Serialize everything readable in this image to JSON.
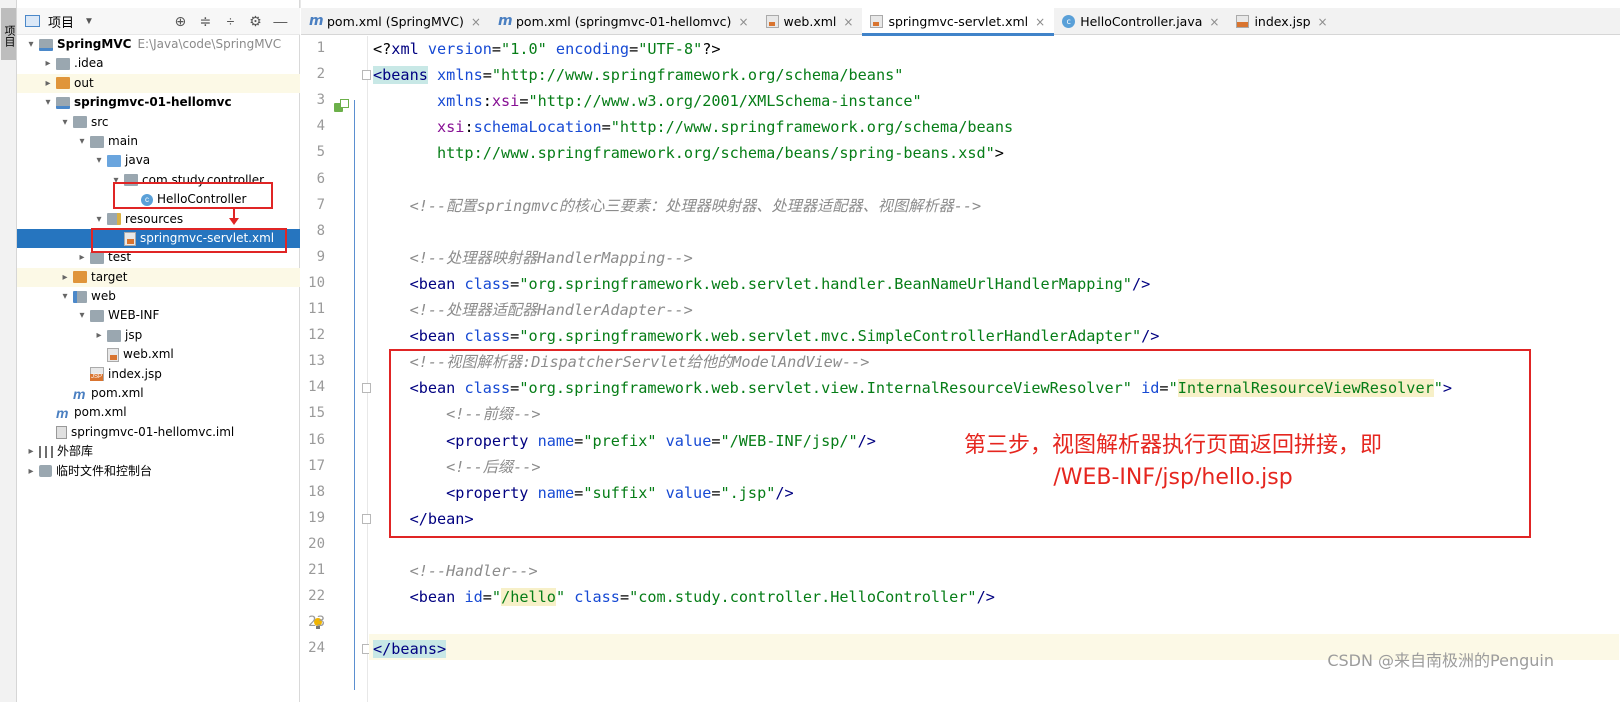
{
  "tool_strip": {
    "project_tab_label": "项目"
  },
  "project_panel": {
    "title": "项目",
    "toolbar_icons": [
      "target-icon",
      "expand-all-icon",
      "collapse-all-icon",
      "gear-icon",
      "minimize-icon"
    ],
    "tree": [
      {
        "label": "SpringMVC",
        "path": "E:\\Java\\code\\SpringMVC",
        "bold": true,
        "depth": 0,
        "arrow": "▾",
        "icon": "folder-module"
      },
      {
        "label": ".idea",
        "depth": 1,
        "arrow": "▸",
        "icon": "folder"
      },
      {
        "label": "out",
        "depth": 1,
        "arrow": "▸",
        "icon": "folder-orange",
        "highlight": true
      },
      {
        "label": "springmvc-01-hellomvc",
        "bold": true,
        "depth": 1,
        "arrow": "▾",
        "icon": "folder-module"
      },
      {
        "label": "src",
        "depth": 2,
        "arrow": "▾",
        "icon": "folder"
      },
      {
        "label": "main",
        "depth": 3,
        "arrow": "▾",
        "icon": "folder"
      },
      {
        "label": "java",
        "depth": 4,
        "arrow": "▾",
        "icon": "folder-blue"
      },
      {
        "label": "com.study.controller",
        "depth": 5,
        "arrow": "▾",
        "icon": "folder"
      },
      {
        "label": "HelloController",
        "depth": 6,
        "arrow": "",
        "icon": "class"
      },
      {
        "label": "resources",
        "depth": 4,
        "arrow": "▾",
        "icon": "folder-res"
      },
      {
        "label": "springmvc-servlet.xml",
        "depth": 5,
        "arrow": "",
        "icon": "xml",
        "selected": true
      },
      {
        "label": "test",
        "depth": 3,
        "arrow": "▸",
        "icon": "folder"
      },
      {
        "label": "target",
        "depth": 2,
        "arrow": "▸",
        "icon": "folder-orange",
        "highlight": true
      },
      {
        "label": "web",
        "depth": 2,
        "arrow": "▾",
        "icon": "folder-web"
      },
      {
        "label": "WEB-INF",
        "depth": 3,
        "arrow": "▾",
        "icon": "folder"
      },
      {
        "label": "jsp",
        "depth": 4,
        "arrow": "▸",
        "icon": "folder"
      },
      {
        "label": "web.xml",
        "depth": 4,
        "arrow": "",
        "icon": "xml"
      },
      {
        "label": "index.jsp",
        "depth": 3,
        "arrow": "",
        "icon": "jsp"
      },
      {
        "label": "pom.xml",
        "depth": 2,
        "arrow": "",
        "icon": "maven"
      },
      {
        "label": "pom.xml",
        "depth": 1,
        "arrow": "",
        "icon": "maven"
      },
      {
        "label": "springmvc-01-hellomvc.iml",
        "depth": 1,
        "arrow": "",
        "icon": "iml"
      },
      {
        "label": "外部库",
        "depth": 0,
        "arrow": "▸",
        "icon": "libs"
      },
      {
        "label": "临时文件和控制台",
        "depth": 0,
        "arrow": "▸",
        "icon": "scratch"
      }
    ]
  },
  "editor": {
    "tabs": [
      {
        "label": "pom.xml (SpringMVC)",
        "icon": "maven"
      },
      {
        "label": "pom.xml (springmvc-01-hellomvc)",
        "icon": "maven"
      },
      {
        "label": "web.xml",
        "icon": "xml"
      },
      {
        "label": "springmvc-servlet.xml",
        "icon": "xml",
        "active": true
      },
      {
        "label": "HelloController.java",
        "icon": "class"
      },
      {
        "label": "index.jsp",
        "icon": "jsp"
      }
    ],
    "close_glyph": "×",
    "lines": [
      [
        [
          "punc",
          "<?"
        ],
        [
          "tag",
          "xml "
        ],
        [
          "attr",
          "version"
        ],
        [
          "punc",
          "="
        ],
        [
          "str",
          "\"1.0\" "
        ],
        [
          "attr",
          "encoding"
        ],
        [
          "punc",
          "="
        ],
        [
          "str",
          "\"UTF-8\""
        ],
        [
          "punc",
          "?>"
        ]
      ],
      [
        [
          "hltag",
          "<beans"
        ],
        [
          "punc",
          " "
        ],
        [
          "attr",
          "xmlns"
        ],
        [
          "punc",
          "="
        ],
        [
          "str",
          "\"http://www.springframework.org/schema/beans\""
        ]
      ],
      [
        [
          "punc",
          "       "
        ],
        [
          "attr",
          "xmlns"
        ],
        [
          "punc",
          ":"
        ],
        [
          "ns",
          "xsi"
        ],
        [
          "punc",
          "="
        ],
        [
          "str",
          "\"http://www.w3.org/2001/XMLSchema-instance\""
        ]
      ],
      [
        [
          "punc",
          "       "
        ],
        [
          "ns",
          "xsi"
        ],
        [
          "punc",
          ":"
        ],
        [
          "attr",
          "schemaLocation"
        ],
        [
          "punc",
          "="
        ],
        [
          "str",
          "\"http://www.springframework.org/schema/beans"
        ]
      ],
      [
        [
          "str",
          "       http://www.springframework.org/schema/beans/spring-beans.xsd\""
        ],
        [
          "punc",
          ">"
        ]
      ],
      [],
      [
        [
          "punc",
          "    "
        ],
        [
          "cmt",
          "<!--配置springmvc的核心三要素：处理器映射器、处理器适配器、视图解析器-->"
        ]
      ],
      [],
      [
        [
          "punc",
          "    "
        ],
        [
          "cmt",
          "<!--处理器映射器HandlerMapping-->"
        ]
      ],
      [
        [
          "punc",
          "    "
        ],
        [
          "tag",
          "<bean "
        ],
        [
          "attr",
          "class"
        ],
        [
          "punc",
          "="
        ],
        [
          "str",
          "\"org.springframework.web.servlet.handler.BeanNameUrlHandlerMapping\""
        ],
        [
          "tag",
          "/>"
        ]
      ],
      [
        [
          "punc",
          "    "
        ],
        [
          "cmt",
          "<!--处理器适配器HandlerAdapter-->"
        ]
      ],
      [
        [
          "punc",
          "    "
        ],
        [
          "tag",
          "<bean "
        ],
        [
          "attr",
          "class"
        ],
        [
          "punc",
          "="
        ],
        [
          "str",
          "\"org.springframework.web.servlet.mvc.SimpleControllerHandlerAdapter\""
        ],
        [
          "tag",
          "/>"
        ]
      ],
      [
        [
          "punc",
          "    "
        ],
        [
          "cmt",
          "<!--视图解析器:DispatcherServlet给他的ModelAndView-->"
        ]
      ],
      [
        [
          "punc",
          "    "
        ],
        [
          "tag",
          "<bean "
        ],
        [
          "attr",
          "class"
        ],
        [
          "punc",
          "="
        ],
        [
          "str",
          "\"org.springframework.web.servlet.view.InternalResourceViewResolver\" "
        ],
        [
          "attr",
          "id"
        ],
        [
          "punc",
          "="
        ],
        [
          "str",
          "\""
        ],
        [
          "hlval",
          "InternalResourceViewResolver"
        ],
        [
          "str",
          "\""
        ],
        [
          "tag",
          ">"
        ]
      ],
      [
        [
          "punc",
          "        "
        ],
        [
          "cmt",
          "<!--前缀-->"
        ]
      ],
      [
        [
          "punc",
          "        "
        ],
        [
          "tag",
          "<property "
        ],
        [
          "attr",
          "name"
        ],
        [
          "punc",
          "="
        ],
        [
          "str",
          "\"prefix\" "
        ],
        [
          "attr",
          "value"
        ],
        [
          "punc",
          "="
        ],
        [
          "str",
          "\"/WEB-INF/jsp/\""
        ],
        [
          "tag",
          "/>"
        ]
      ],
      [
        [
          "punc",
          "        "
        ],
        [
          "cmt",
          "<!--后缀-->"
        ]
      ],
      [
        [
          "punc",
          "        "
        ],
        [
          "tag",
          "<property "
        ],
        [
          "attr",
          "name"
        ],
        [
          "punc",
          "="
        ],
        [
          "str",
          "\"suffix\" "
        ],
        [
          "attr",
          "value"
        ],
        [
          "punc",
          "="
        ],
        [
          "str",
          "\".jsp\""
        ],
        [
          "tag",
          "/>"
        ]
      ],
      [
        [
          "punc",
          "    "
        ],
        [
          "tag",
          "</bean>"
        ]
      ],
      [],
      [
        [
          "punc",
          "    "
        ],
        [
          "cmt",
          "<!--Handler-->"
        ]
      ],
      [
        [
          "punc",
          "    "
        ],
        [
          "tag",
          "<bean "
        ],
        [
          "attr",
          "id"
        ],
        [
          "punc",
          "="
        ],
        [
          "str",
          "\""
        ],
        [
          "hlval",
          "/hello"
        ],
        [
          "str",
          "\" "
        ],
        [
          "attr",
          "class"
        ],
        [
          "punc",
          "="
        ],
        [
          "str",
          "\"com.study.controller.HelloController\""
        ],
        [
          "tag",
          "/>"
        ]
      ],
      [],
      [
        [
          "hltag",
          "</beans>"
        ]
      ]
    ],
    "current_line": 24
  },
  "annotation": {
    "line1": "第三步，视图解析器执行页面返回拼接，即",
    "line2": "/WEB-INF/jsp/hello.jsp"
  },
  "watermark": "CSDN @来自南极洲的Penguin"
}
